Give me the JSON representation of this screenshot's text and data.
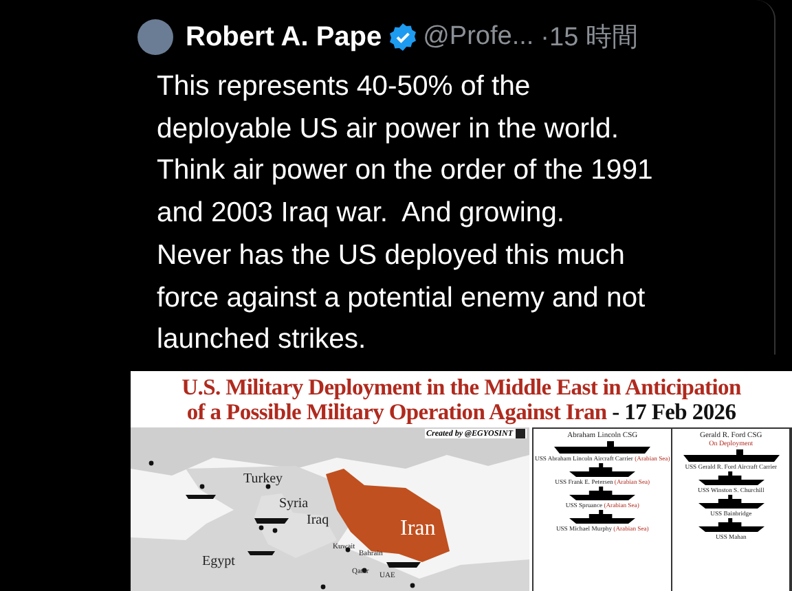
{
  "post": {
    "author": "Robert A. Pape",
    "verified": true,
    "handle": "@Profe...",
    "time": "·15 時間",
    "text": "This represents 40-50% of the\ndeployable US air power in the world.\nThink air power on the order of the 1991\nand 2003 Iraq war.  And growing.\nNever has the US deployed this much\nforce against a potential enemy and not\nlaunched strikes."
  },
  "infographic": {
    "title_lines": [
      "U.S. Military Deployment in the Middle East in Anticipation",
      "of a Possible Military Operation Against Iran"
    ],
    "date": " - 17 Feb 2026",
    "credit": "Created by @EGYOSINT",
    "map_labels": [
      {
        "text": "Turkey",
        "kind": "country"
      },
      {
        "text": "Syria",
        "kind": "country"
      },
      {
        "text": "Iraq",
        "kind": "country"
      },
      {
        "text": "Iran",
        "kind": "target"
      },
      {
        "text": "Egypt",
        "kind": "country"
      },
      {
        "text": "Kuwait",
        "kind": "small"
      },
      {
        "text": "Bahrain",
        "kind": "small"
      },
      {
        "text": "Qatar",
        "kind": "small"
      },
      {
        "text": "UAE",
        "kind": "small"
      }
    ],
    "groups": [
      {
        "name": "Abraham Lincoln CSG",
        "ships": [
          {
            "name": "USS Abraham Lincoln Aircraft Carrier",
            "location": "(Arabian Sea)",
            "kind": "carrier"
          },
          {
            "name": "USS Frank E. Petersen",
            "location": "(Arabian Sea)",
            "kind": "destroyer"
          },
          {
            "name": "USS Spruance",
            "location": "(Arabian Sea)",
            "kind": "destroyer"
          },
          {
            "name": "USS Michael Murphy",
            "location": "(Arabian Sea)",
            "kind": "destroyer"
          }
        ]
      },
      {
        "name": "Gerald R. Ford CSG",
        "status": "On Deployment",
        "ships": [
          {
            "name": "USS Gerald R. Ford Aircraft Carrier",
            "kind": "carrier"
          },
          {
            "name": "USS Winston S. Churchill",
            "kind": "destroyer"
          },
          {
            "name": "USS Bainbridge",
            "kind": "destroyer"
          },
          {
            "name": "USS Mahan",
            "kind": "destroyer"
          }
        ]
      }
    ]
  }
}
